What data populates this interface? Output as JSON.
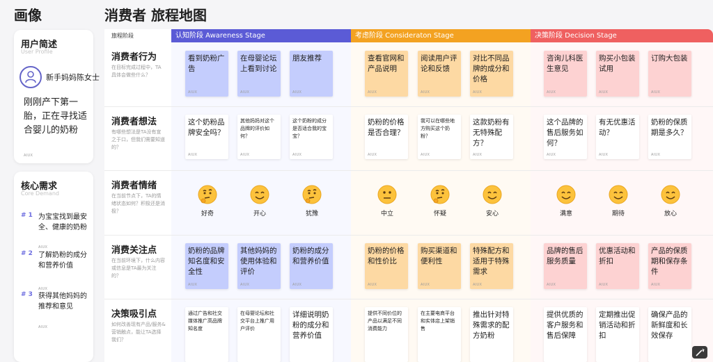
{
  "headers": {
    "left_title": "画像",
    "main_title": "消费者 旅程地图"
  },
  "profile": {
    "title": "用户简述",
    "subtitle": "User Profile",
    "name": "新手妈妈陈女士",
    "description": "刚刚产下第一胎，正在寻找适合婴儿的奶粉",
    "aux": "AIUX"
  },
  "demand": {
    "title": "核心需求",
    "subtitle": "Core Demand",
    "items": [
      {
        "num": "# 1",
        "text": "为宝宝找到最安全、健康的奶粉",
        "aux": "AIUX"
      },
      {
        "num": "# 2",
        "text": "了解奶粉的成分和营养价值",
        "aux": "AIUX"
      },
      {
        "num": "# 3",
        "text": "获得其他妈妈的推荐和意见",
        "aux": "AIUX"
      }
    ]
  },
  "stage_label": "旅程阶段",
  "stages": [
    {
      "label": "认知阶段 Awareness Stage",
      "color": "#5b5bd6",
      "band": "#f7f8ff"
    },
    {
      "label": "考虑阶段 Consideraton Stage",
      "color": "#f3a221",
      "band": "#fffaf3"
    },
    {
      "label": "决策阶段 Decision Stage",
      "color": "#ef6060",
      "band": "#fff7f7"
    }
  ],
  "rows": [
    {
      "title": "消费者行为",
      "sub": "在目标完成过程中，TA具体会做些什么？",
      "cards": [
        {
          "text": "看到奶粉广告",
          "aux": "AIUX"
        },
        {
          "text": "在母婴论坛上看到讨论",
          "aux": "AIUX"
        },
        {
          "text": "朋友推荐",
          "aux": "AIUX"
        },
        {
          "text": "查看官网和产品说明",
          "aux": "AIUX"
        },
        {
          "text": "阅读用户评论和反馈",
          "aux": "AIUX"
        },
        {
          "text": "对比不同品牌的成分和价格",
          "aux": "AIUX"
        },
        {
          "text": "咨询儿科医生意见",
          "aux": "AIUX"
        },
        {
          "text": "购买小包装试用",
          "aux": "AIUX"
        },
        {
          "text": "订购大包装",
          "aux": "AIUX"
        }
      ]
    },
    {
      "title": "消费者想法",
      "sub": "有哪些想法是TA没有宣之于口，但我们需要知道的？",
      "cards": [
        {
          "text": "这个奶粉品牌安全吗？",
          "aux": "AIUX"
        },
        {
          "text": "其他妈妈对这个品牌的评价如何？",
          "aux": "AIUX"
        },
        {
          "text": "这个奶粉的成分是否适合我的宝宝？",
          "aux": "AIUX"
        },
        {
          "text": "奶粉的价格是否合理？",
          "aux": "AIUX"
        },
        {
          "text": "我可以在哪些地方购买这个奶粉？",
          "aux": "AIUX"
        },
        {
          "text": "这款奶粉有无特殊配方？",
          "aux": "AIUX"
        },
        {
          "text": "这个品牌的售后服务如何？",
          "aux": "AIUX"
        },
        {
          "text": "有无优惠活动？",
          "aux": "AIUX"
        },
        {
          "text": "奶粉的保质期是多久？",
          "aux": "AIUX"
        }
      ]
    },
    {
      "title": "消费者情绪",
      "sub": "在当前节点下，TA的情绪状态如何？积极还是消极？",
      "emotions": [
        {
          "face": "thinking-face-icon",
          "label": "好奇"
        },
        {
          "face": "smiling-face-icon",
          "label": "开心"
        },
        {
          "face": "thinking-face-icon",
          "label": "犹豫"
        },
        {
          "face": "neutral-face-icon",
          "label": "中立"
        },
        {
          "face": "thinking-face-icon",
          "label": "怀疑"
        },
        {
          "face": "smiling-face-icon",
          "label": "安心"
        },
        {
          "face": "smiling-face-icon",
          "label": "满意"
        },
        {
          "face": "smiling-face-icon",
          "label": "期待"
        },
        {
          "face": "smiling-face-icon",
          "label": "放心"
        }
      ]
    },
    {
      "title": "消费关注点",
      "sub": "在当前环境下，什么内容或信息是TA最为关注的？",
      "cards": [
        {
          "text": "奶粉的品牌知名度和安全性",
          "aux": "AIUX"
        },
        {
          "text": "其他妈妈的使用体验和评价",
          "aux": "AIUX"
        },
        {
          "text": "奶粉的成分和营养价值",
          "aux": "AIUX"
        },
        {
          "text": "奶粉的价格和性价比",
          "aux": "AIUX"
        },
        {
          "text": "购买渠道和便利性",
          "aux": "AIUX"
        },
        {
          "text": "特殊配方和适用于特殊需求",
          "aux": "AIUX"
        },
        {
          "text": "品牌的售后服务质量",
          "aux": "AIUX"
        },
        {
          "text": "优惠活动和折扣",
          "aux": "AIUX"
        },
        {
          "text": "产品的保质期和保存条件",
          "aux": "AIUX"
        }
      ]
    },
    {
      "title": "决策吸引点",
      "sub": "如何改善现有产品/服务&营销触点，能让TA选择我们？",
      "cards": [
        {
          "text": "通过广告和社交媒体推广高品牌知名度"
        },
        {
          "text": "在母婴论坛和社交平台上推广用户评价"
        },
        {
          "text": "详细说明奶粉的成分和营养价值"
        },
        {
          "text": "提供不同价位的产品以满足不同消费能力"
        },
        {
          "text": "在主要电商平台和实体店上架销售"
        },
        {
          "text": "推出针对特殊需求的配方奶粉"
        },
        {
          "text": "提供优质的客户服务和售后保障"
        },
        {
          "text": "定期推出促销活动和折扣"
        },
        {
          "text": "确保产品的新鲜度和长效保存"
        }
      ]
    }
  ]
}
